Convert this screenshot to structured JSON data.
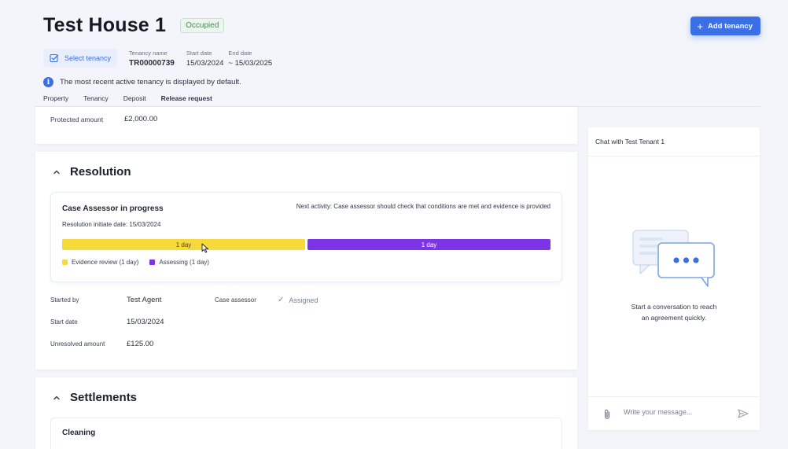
{
  "header": {
    "title": "Test House 1",
    "status": "Occupied",
    "add_tenancy_label": "Add tenancy"
  },
  "tenancy": {
    "select_label": "Select tenancy",
    "name_label": "Tenancy name",
    "name_value": "TR00000739",
    "start_label": "Start date",
    "start_value": "15/03/2024",
    "end_label": "End date",
    "end_value": "~ 15/03/2025"
  },
  "info_message": "The most recent active tenancy is displayed by default.",
  "tabs": [
    {
      "label": "Property",
      "active": false
    },
    {
      "label": "Tenancy",
      "active": false
    },
    {
      "label": "Deposit",
      "active": false
    },
    {
      "label": "Release request",
      "active": true
    }
  ],
  "protected": {
    "label": "Protected amount",
    "value": "£2,000.00"
  },
  "resolution": {
    "title": "Resolution",
    "status_title": "Case Assessor in progress",
    "next_activity": "Next activity: Case assessor should check that conditions are met and evidence is provided",
    "initiate_date": "Resolution initiate date:  15/03/2024",
    "bars": [
      {
        "label": "1 day",
        "color": "#f7d93a",
        "fraction": 0.5
      },
      {
        "label": "1 day",
        "color": "#7d34e6",
        "fraction": 0.5
      }
    ],
    "legend": [
      {
        "label": "Evidence review (1 day)",
        "color": "#f7d93a"
      },
      {
        "label": "Assessing (1 day)",
        "color": "#7d34e6"
      }
    ],
    "started_by_label": "Started by",
    "started_by_value": "Test Agent",
    "case_assessor_label": "Case assessor",
    "case_assessor_value": "Assigned",
    "start_date_label": "Start date",
    "start_date_value": "15/03/2024",
    "unresolved_label": "Unresolved amount",
    "unresolved_value": "£125.00"
  },
  "settlements": {
    "title": "Settlements",
    "first_item": "Cleaning"
  },
  "chat": {
    "title": "Chat with Test Tenant 1",
    "empty_line1": "Start a conversation to reach",
    "empty_line2": "an agreement quickly.",
    "placeholder": "Write your message..."
  },
  "colors": {
    "accent": "#3b6fe6",
    "evidence": "#f7d93a",
    "assessing": "#7d34e6"
  }
}
